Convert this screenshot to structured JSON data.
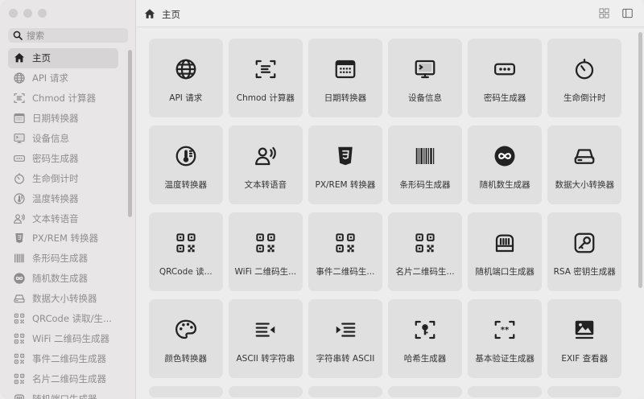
{
  "search": {
    "placeholder": "搜索"
  },
  "sidebar": {
    "items": [
      {
        "label": "主页",
        "icon": "home-icon",
        "active": true
      },
      {
        "label": "API 请求",
        "icon": "globe-icon"
      },
      {
        "label": "Chmod 计算器",
        "icon": "file-scan-icon"
      },
      {
        "label": "日期转换器",
        "icon": "calendar-icon"
      },
      {
        "label": "设备信息",
        "icon": "monitor-icon"
      },
      {
        "label": "密码生成器",
        "icon": "password-icon"
      },
      {
        "label": "生命倒计时",
        "icon": "timer-icon"
      },
      {
        "label": "温度转换器",
        "icon": "thermometer-icon"
      },
      {
        "label": "文本转语音",
        "icon": "speaker-person-icon"
      },
      {
        "label": "PX/REM 转换器",
        "icon": "css-icon"
      },
      {
        "label": "条形码生成器",
        "icon": "barcode-icon"
      },
      {
        "label": "随机数生成器",
        "icon": "infinity-icon"
      },
      {
        "label": "数据大小转换器",
        "icon": "disk-icon"
      },
      {
        "label": "QRCode 读取/生...",
        "icon": "qrcode-icon"
      },
      {
        "label": "WiFi 二维码生成器",
        "icon": "qrcode-icon"
      },
      {
        "label": "事件二维码生成器",
        "icon": "qrcode-icon"
      },
      {
        "label": "名片二维码生成器",
        "icon": "qrcode-icon"
      },
      {
        "label": "随机端口生成器",
        "icon": "port-icon"
      }
    ]
  },
  "header": {
    "title": "主页"
  },
  "cards": [
    {
      "label": "API 请求",
      "icon": "globe-icon"
    },
    {
      "label": "Chmod 计算器",
      "icon": "file-scan-icon"
    },
    {
      "label": "日期转换器",
      "icon": "calendar-icon"
    },
    {
      "label": "设备信息",
      "icon": "monitor-icon"
    },
    {
      "label": "密码生成器",
      "icon": "password-icon"
    },
    {
      "label": "生命倒计时",
      "icon": "timer-icon"
    },
    {
      "label": "温度转换器",
      "icon": "thermometer-icon"
    },
    {
      "label": "文本转语音",
      "icon": "speaker-person-icon"
    },
    {
      "label": "PX/REM 转换器",
      "icon": "css-icon"
    },
    {
      "label": "条形码生成器",
      "icon": "barcode-icon"
    },
    {
      "label": "随机数生成器",
      "icon": "infinity-icon"
    },
    {
      "label": "数据大小转换器",
      "icon": "disk-icon"
    },
    {
      "label": "QRCode 读...",
      "icon": "qrcode-icon"
    },
    {
      "label": "WiFi 二维码生...",
      "icon": "qrcode-icon"
    },
    {
      "label": "事件二维码生...",
      "icon": "qrcode-icon"
    },
    {
      "label": "名片二维码生...",
      "icon": "qrcode-icon"
    },
    {
      "label": "随机端口生成器",
      "icon": "port-icon"
    },
    {
      "label": "RSA 密钥生成器",
      "icon": "key-icon"
    },
    {
      "label": "颜色转换器",
      "icon": "palette-icon"
    },
    {
      "label": "ASCII 转字符串",
      "icon": "text-arrow-left-icon"
    },
    {
      "label": "字符串转 ASCII",
      "icon": "text-arrow-right-icon"
    },
    {
      "label": "哈希生成器",
      "icon": "hash-key-icon"
    },
    {
      "label": "基本验证生成器",
      "icon": "auth-icon"
    },
    {
      "label": "EXIF 查看器",
      "icon": "image-icon"
    }
  ]
}
